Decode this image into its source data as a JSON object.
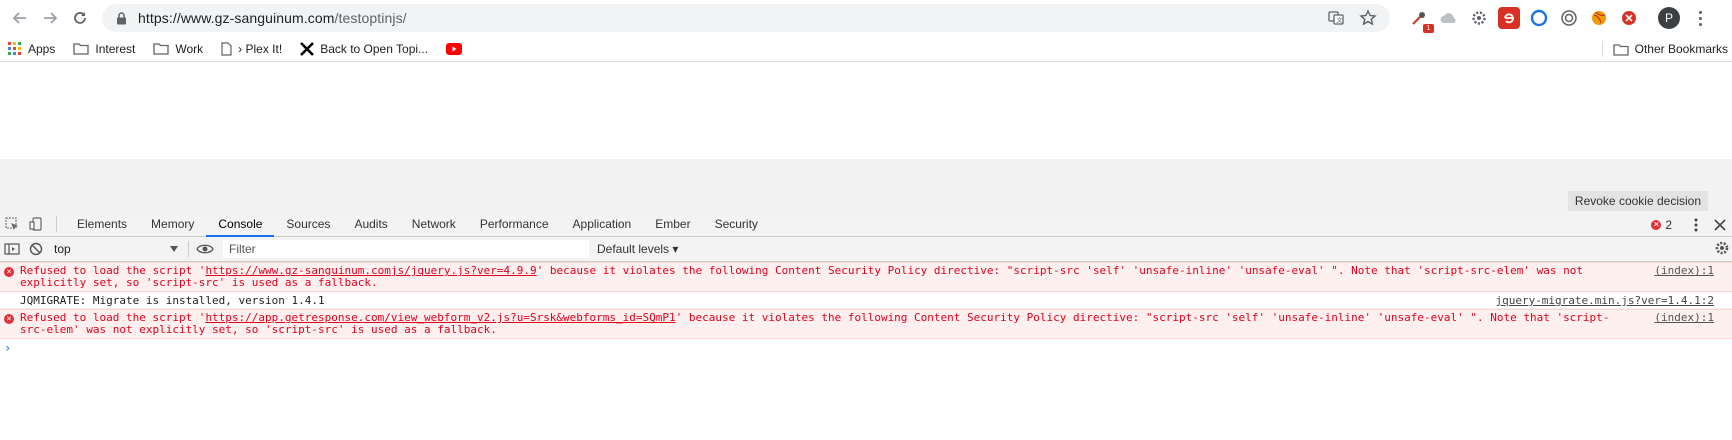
{
  "browser": {
    "url_host": "https://www.gz-sanguinum.com",
    "url_path": "/testoptinjs/",
    "profile_initial": "P",
    "extension_badge": "1"
  },
  "bookmarks": {
    "items": [
      {
        "label": "Apps",
        "icon": "apps-grid-icon"
      },
      {
        "label": "Interest",
        "icon": "folder-icon"
      },
      {
        "label": "Work",
        "icon": "folder-icon"
      },
      {
        "label": "› Plex It!",
        "icon": "page-icon"
      },
      {
        "label": "Back to Open Topi...",
        "icon": "x-logo-icon"
      },
      {
        "label": "",
        "icon": "youtube-icon"
      }
    ],
    "other_label": "Other Bookmarks"
  },
  "page": {
    "revoke_cookie_label": "Revoke cookie decision"
  },
  "devtools": {
    "tabs": [
      "Elements",
      "Memory",
      "Console",
      "Sources",
      "Audits",
      "Network",
      "Performance",
      "Application",
      "Ember",
      "Security"
    ],
    "active_tab": "Console",
    "error_count": "2",
    "context": "top",
    "filter_placeholder": "Filter",
    "levels_label": "Default levels ▾",
    "colors": {
      "error_bg": "#fff0f0",
      "error_text": "#e0001c",
      "accent": "#1a73e8"
    }
  },
  "console": {
    "messages": [
      {
        "level": "error",
        "prefix": "Refused to load the script '",
        "link": "https://www.gz-sanguinum.comjs/jquery.js?ver=4.9.9",
        "suffix": "' because it violates the following Content Security Policy directive: \"script-src 'self' 'unsafe-inline' 'unsafe-eval' \". Note that 'script-src-elem' was not explicitly set, so 'script-src' is used as a fallback.",
        "source": "(index):1"
      },
      {
        "level": "log",
        "text": "JQMIGRATE: Migrate is installed, version 1.4.1",
        "source": "jquery-migrate.min.js?ver=1.4.1:2"
      },
      {
        "level": "error",
        "prefix": "Refused to load the script '",
        "link": "https://app.getresponse.com/view_webform_v2.js?u=Srsk&webforms_id=SQmP1",
        "suffix": "' because it violates the following Content Security Policy directive: \"script-src 'self' 'unsafe-inline' 'unsafe-eval' \". Note that 'script-src-elem' was not explicitly set, so 'script-src' is used as a fallback.",
        "source": "(index):1"
      }
    ],
    "prompt": "›"
  }
}
